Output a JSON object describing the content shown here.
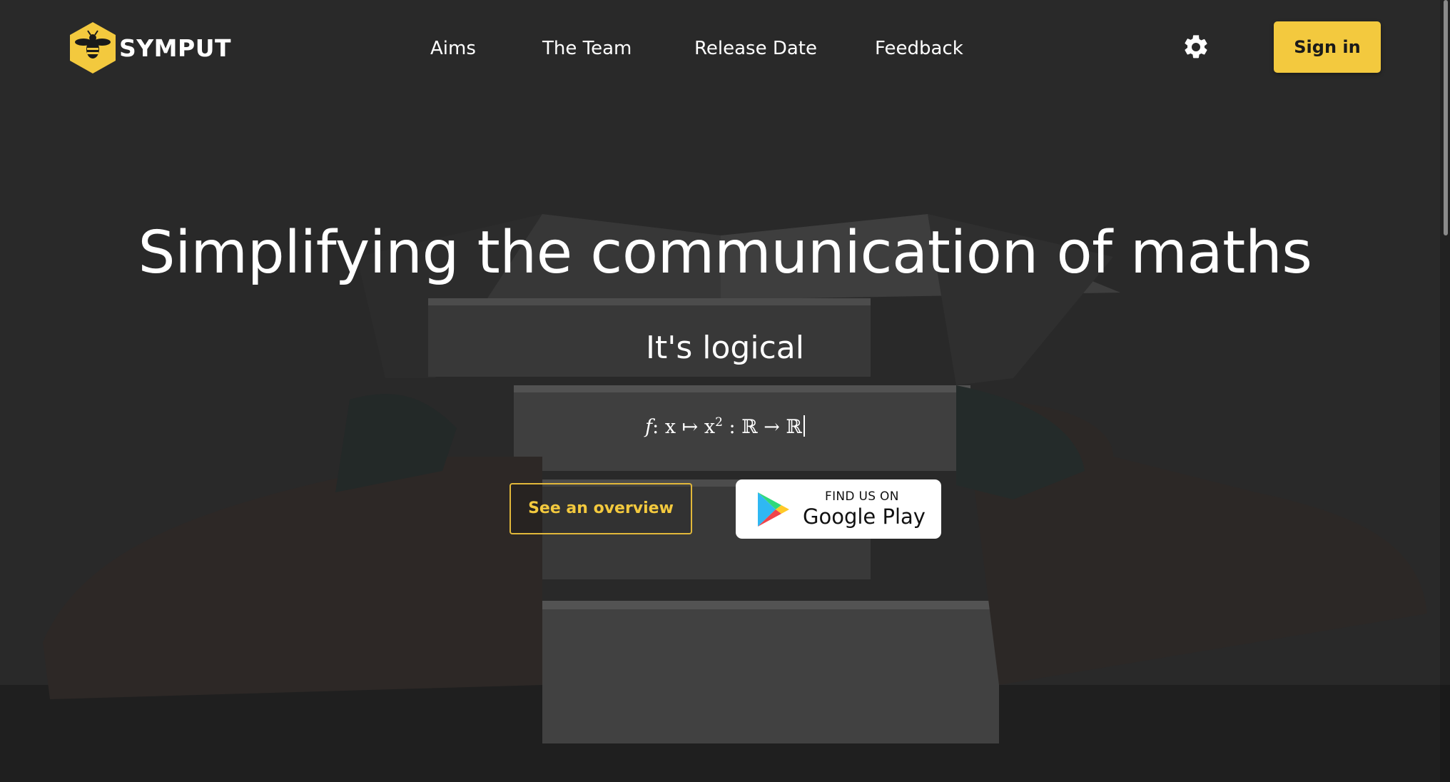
{
  "brand": {
    "name": "SYMPUT",
    "accent_color": "#f3c93e",
    "logo_icon": "bee-hexagon-icon"
  },
  "nav": {
    "items": [
      {
        "label": "Aims"
      },
      {
        "label": "The Team"
      },
      {
        "label": "Release Date"
      },
      {
        "label": "Feedback"
      }
    ]
  },
  "header": {
    "settings_icon": "gear-icon",
    "signin_label": "Sign in"
  },
  "hero": {
    "title": "Simplifying the communication of maths",
    "subtitle": "It's logical",
    "formula": {
      "f": "f",
      "sep1": ": x ↦ x",
      "exp": "2",
      "rest": " : ℝ → ℝ"
    },
    "overview_label": "See an overview",
    "store": {
      "small_label": "FIND US ON",
      "big_label": "Google Play",
      "icon": "google-play-icon"
    }
  }
}
